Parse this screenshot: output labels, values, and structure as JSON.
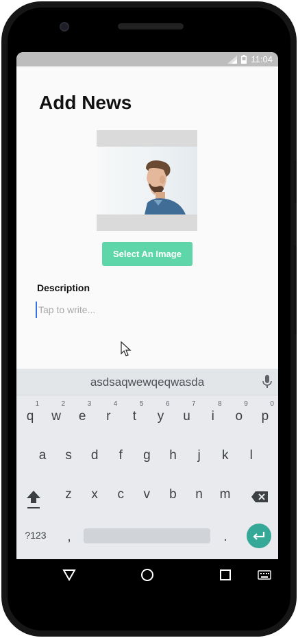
{
  "status_bar": {
    "time": "11:04"
  },
  "page": {
    "title": "Add News",
    "select_image_label": "Select An Image",
    "description_label": "Description",
    "description_placeholder": "Tap to write..."
  },
  "keyboard": {
    "suggestion": "asdsaqwewqeqwasda",
    "row1": [
      {
        "k": "q",
        "h": "1"
      },
      {
        "k": "w",
        "h": "2"
      },
      {
        "k": "e",
        "h": "3"
      },
      {
        "k": "r",
        "h": "4"
      },
      {
        "k": "t",
        "h": "5"
      },
      {
        "k": "y",
        "h": "6"
      },
      {
        "k": "u",
        "h": "7"
      },
      {
        "k": "i",
        "h": "8"
      },
      {
        "k": "o",
        "h": "9"
      },
      {
        "k": "p",
        "h": "0"
      }
    ],
    "row2": [
      "a",
      "s",
      "d",
      "f",
      "g",
      "h",
      "j",
      "k",
      "l"
    ],
    "row3": [
      "z",
      "x",
      "c",
      "v",
      "b",
      "n",
      "m"
    ],
    "symbols_label": "?123",
    "comma": ",",
    "period": "."
  },
  "colors": {
    "accent_button": "#5fd6a9",
    "enter_key": "#36a897",
    "status_bar": "#bdbdbd"
  }
}
